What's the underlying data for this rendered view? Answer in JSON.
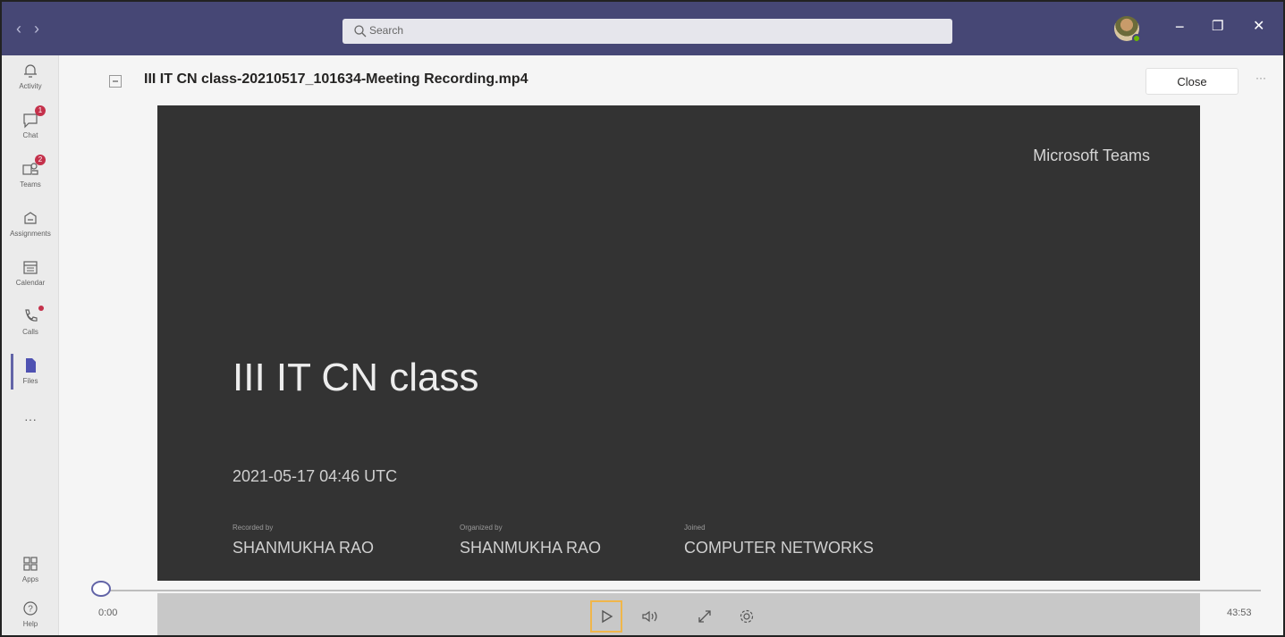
{
  "titlebar": {
    "search_placeholder": "Search",
    "nav_back": "‹",
    "nav_forward": "›",
    "minimize": "−",
    "restore": "❐",
    "close": "✕"
  },
  "rail": {
    "items": [
      {
        "label": "Activity",
        "icon": "bell-icon"
      },
      {
        "label": "Chat",
        "icon": "chat-icon",
        "badge": "1"
      },
      {
        "label": "Teams",
        "icon": "teams-icon",
        "badge": "2"
      },
      {
        "label": "Assignments",
        "icon": "assignments-icon"
      },
      {
        "label": "Calendar",
        "icon": "calendar-icon"
      },
      {
        "label": "Calls",
        "icon": "phone-icon"
      },
      {
        "label": "Files",
        "icon": "file-icon"
      },
      {
        "label": "···",
        "icon": "more-icon"
      },
      {
        "label": "Apps",
        "icon": "apps-icon"
      },
      {
        "label": "Help",
        "icon": "help-icon"
      }
    ]
  },
  "header": {
    "title": "III IT CN class-20210517_101634-Meeting Recording.mp4",
    "close_label": "Close",
    "more": "···"
  },
  "video": {
    "brand": "Microsoft Teams",
    "title": "III IT CN class",
    "date": "2021-05-17 04:46 UTC",
    "meta": [
      {
        "label": "Recorded by",
        "value": "SHANMUKHA RAO"
      },
      {
        "label": "Organized by",
        "value": "SHANMUKHA RAO"
      },
      {
        "label": "Joined",
        "value": "COMPUTER NETWORKS"
      }
    ]
  },
  "player": {
    "current_time": "0:00",
    "total_time": "43:53",
    "progress": 0
  },
  "colors": {
    "titlebar": "#464775",
    "accent": "#6264a7",
    "video_bg": "#333333",
    "controls_bg": "#c8c8c8",
    "focus": "#f0b64a",
    "badge": "#c4314b"
  }
}
